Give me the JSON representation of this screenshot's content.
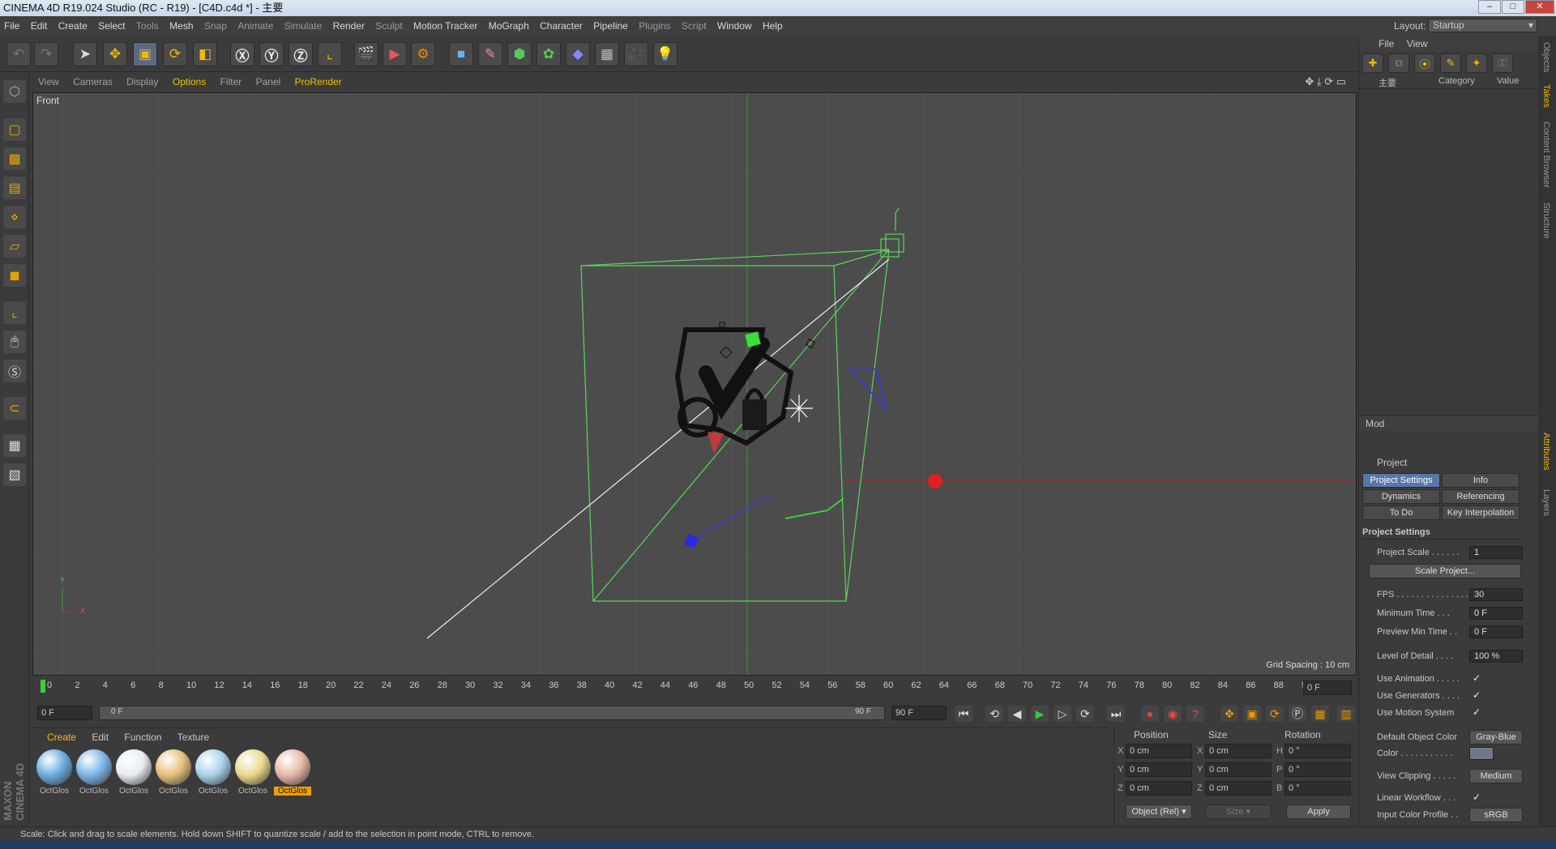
{
  "app": {
    "title": "CINEMA 4D R19.024 Studio (RC - R19) - [C4D.c4d *] - 主要"
  },
  "menu": [
    "File",
    "Edit",
    "Create",
    "Select",
    "Tools",
    "Mesh",
    "Snap",
    "Animate",
    "Simulate",
    "Render",
    "Sculpt",
    "Motion Tracker",
    "MoGraph",
    "Character",
    "Pipeline",
    "Plugins",
    "Script",
    "Window",
    "Help"
  ],
  "layout": {
    "label": "Layout:",
    "value": "Startup"
  },
  "view_menu": [
    "View",
    "Cameras",
    "Display",
    "Options",
    "Filter",
    "Panel",
    "ProRender"
  ],
  "viewport": {
    "name": "Front",
    "grid_spacing": "Grid Spacing : 10 cm",
    "axis_y": "Y",
    "axis_x": "X"
  },
  "timeline": {
    "ticks": [
      "0",
      "2",
      "4",
      "6",
      "8",
      "10",
      "12",
      "14",
      "16",
      "18",
      "20",
      "22",
      "24",
      "26",
      "28",
      "30",
      "32",
      "34",
      "36",
      "38",
      "40",
      "42",
      "44",
      "46",
      "48",
      "50",
      "52",
      "54",
      "56",
      "58",
      "60",
      "62",
      "64",
      "66",
      "68",
      "70",
      "72",
      "74",
      "76",
      "78",
      "80",
      "82",
      "84",
      "86",
      "88",
      "90"
    ],
    "current": "0 F"
  },
  "range": {
    "start": "0 F",
    "slider_start": "0 F",
    "slider_end": "90 F",
    "end": "90 F"
  },
  "material_menu": [
    "Create",
    "Edit",
    "Function",
    "Texture"
  ],
  "materials": [
    {
      "name": "OctGlos",
      "color": "#6aaee0"
    },
    {
      "name": "OctGlos",
      "color": "#7ab6e6"
    },
    {
      "name": "OctGlos",
      "color": "#e8ecf0"
    },
    {
      "name": "OctGlos",
      "color": "#e6c07a"
    },
    {
      "name": "OctGlos",
      "color": "#a8d2ea"
    },
    {
      "name": "OctGlos",
      "color": "#ead88a"
    },
    {
      "name": "OctGlos",
      "color": "#e6b8a6"
    }
  ],
  "coords": {
    "headers": [
      "Position",
      "Size",
      "Rotation"
    ],
    "rows": [
      {
        "axis": "X",
        "pos": "0 cm",
        "saxis": "X",
        "size": "0 cm",
        "raxis": "H",
        "rot": "0 °"
      },
      {
        "axis": "Y",
        "pos": "0 cm",
        "saxis": "Y",
        "size": "0 cm",
        "raxis": "P",
        "rot": "0 °"
      },
      {
        "axis": "Z",
        "pos": "0 cm",
        "saxis": "Z",
        "size": "0 cm",
        "raxis": "B",
        "rot": "0 °"
      }
    ],
    "mode": "Object (Rel)",
    "size_mode": "Size",
    "apply": "Apply"
  },
  "objects_panel": {
    "menu": [
      "File",
      "View"
    ],
    "col_name": "主要",
    "col_category": "Category",
    "col_value": "Value"
  },
  "attributes": {
    "menu": "Mod",
    "title": "Project",
    "tabs": [
      "Project Settings",
      "Info",
      "Dynamics",
      "Referencing",
      "To Do",
      "Key Interpolation"
    ],
    "section": "Project Settings",
    "rows": [
      {
        "label": "Project Scale . . . . . .",
        "value": "1"
      },
      {
        "label": "FPS . . . . . . . . . . . . . . .",
        "value": "30"
      },
      {
        "label": "Minimum Time . . .",
        "value": "0 F"
      },
      {
        "label": "Preview Min Time . .",
        "value": "0 F"
      },
      {
        "label": "Level of Detail . . . .",
        "value": "100 %"
      }
    ],
    "scale_button": "Scale Project...",
    "checks": [
      {
        "label": "Use Animation . . . . .",
        "value": "✓"
      },
      {
        "label": "Use Generators . . . .",
        "value": "✓"
      },
      {
        "label": "Use Motion System",
        "value": "✓"
      }
    ],
    "default_color": {
      "label": "Default Object Color",
      "value": "Gray-Blue"
    },
    "color": {
      "label": "Color . . . . . . . . . . ."
    },
    "view_clipping": {
      "label": "View Clipping . . . . .",
      "value": "Medium"
    },
    "linear_workflow": {
      "label": "Linear Workflow . . .",
      "value": "✓"
    },
    "input_color": {
      "label": "Input Color Profile . .",
      "value": "sRGB"
    }
  },
  "side_tabs": [
    "Objects",
    "Takes",
    "Content Browser",
    "Structure",
    "Attributes",
    "Layers"
  ],
  "status": "Scale: Click and drag to scale elements. Hold down SHIFT to quantize scale / add to the selection in point mode, CTRL to remove.",
  "brand": "MAXON CINEMA 4D"
}
